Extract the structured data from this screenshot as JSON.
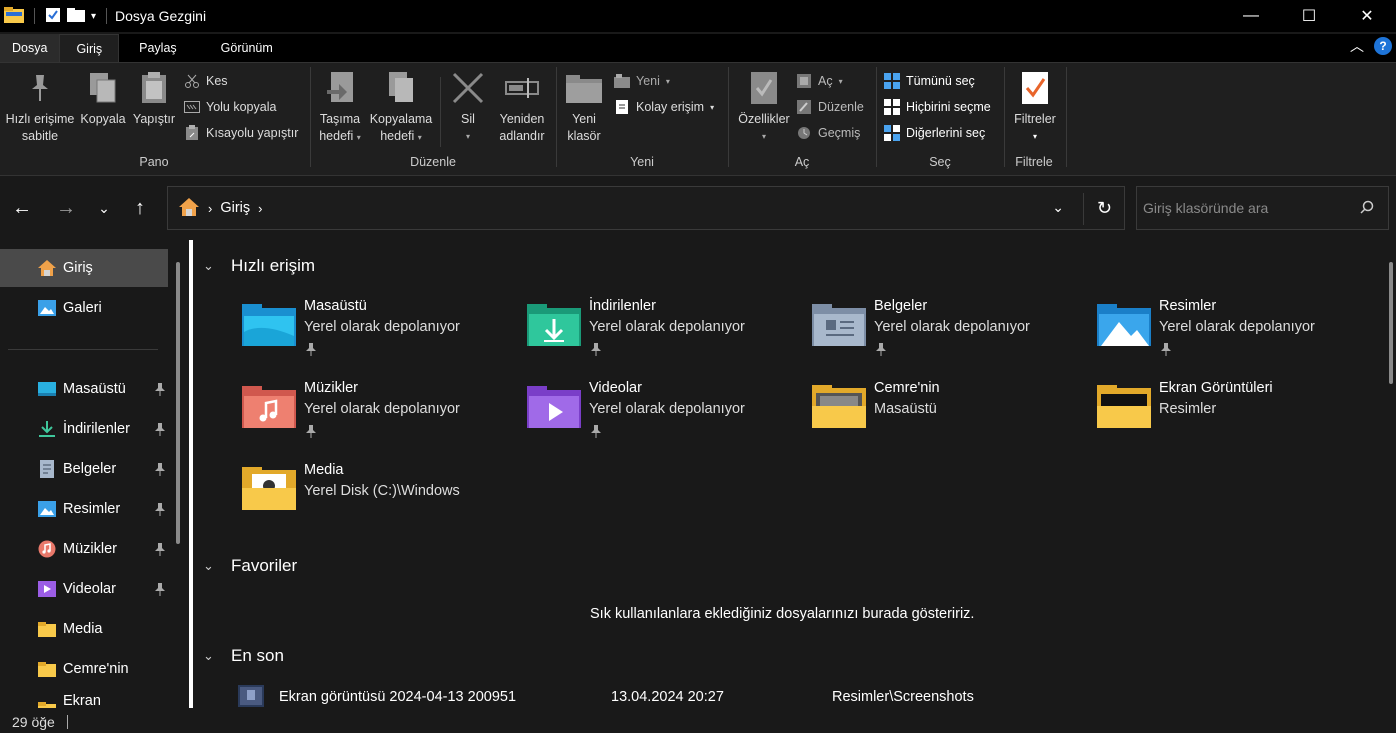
{
  "window": {
    "title": "Dosya Gezgini",
    "controls": {
      "minimize": "—",
      "maximize": "☐",
      "close": "✕"
    }
  },
  "ribbon_tabs": [
    "Dosya",
    "Giriş",
    "Paylaş",
    "Görünüm"
  ],
  "ribbon": {
    "pano": {
      "label": "Pano",
      "pin": "Hızlı erişime\nsabitle",
      "pin_l1": "Hızlı erişime",
      "pin_l2": "sabitle",
      "copy": "Kopyala",
      "paste": "Yapıştır",
      "cut": "Kes",
      "copy_path": "Yolu kopyala",
      "paste_shortcut": "Kısayolu yapıştır"
    },
    "duzenle": {
      "label": "Düzenle",
      "move_l1": "Taşıma",
      "move_l2": "hedefi",
      "copy_l1": "Kopyalama",
      "copy_l2": "hedefi",
      "delete": "Sil",
      "rename_l1": "Yeniden",
      "rename_l2": "adlandır"
    },
    "yeni": {
      "label": "Yeni",
      "folder_l1": "Yeni",
      "folder_l2": "klasör",
      "new_item": "Yeni",
      "easy_access": "Kolay erişim"
    },
    "ac": {
      "label": "Aç",
      "properties": "Özellikler",
      "open": "Aç",
      "edit": "Düzenle",
      "history": "Geçmiş"
    },
    "sec": {
      "label": "Seç",
      "select_all": "Tümünü seç",
      "select_none": "Hiçbirini seçme",
      "invert": "Diğerlerini seç"
    },
    "filtrele": {
      "label": "Filtrele",
      "filters": "Filtreler"
    }
  },
  "address": {
    "crumb": "Giriş",
    "chevron": "›"
  },
  "search": {
    "placeholder": "Giriş klasöründe ara"
  },
  "sidebar": {
    "top": [
      {
        "label": "Giriş",
        "icon": "home-icon",
        "selected": true
      },
      {
        "label": "Galeri",
        "icon": "gallery-icon"
      }
    ],
    "pinned": [
      {
        "label": "Masaüstü",
        "icon": "desktop-icon",
        "pinned": true
      },
      {
        "label": "İndirilenler",
        "icon": "download-icon",
        "pinned": true
      },
      {
        "label": "Belgeler",
        "icon": "documents-icon",
        "pinned": true
      },
      {
        "label": "Resimler",
        "icon": "pictures-icon",
        "pinned": true
      },
      {
        "label": "Müzikler",
        "icon": "music-icon",
        "pinned": true
      },
      {
        "label": "Videolar",
        "icon": "videos-icon",
        "pinned": true
      },
      {
        "label": "Media",
        "icon": "folder-icon",
        "pinned": false
      },
      {
        "label": "Cemre'nin",
        "icon": "folder-icon",
        "pinned": false
      },
      {
        "label": "Ekran Görüntüle",
        "icon": "folder-icon",
        "pinned": false
      }
    ]
  },
  "quick_access": {
    "header": "Hızlı erişim",
    "tiles": [
      {
        "name": "Masaüstü",
        "sub": "Yerel olarak depolanıyor",
        "icon": "desktop-folder-icon",
        "pinned": true
      },
      {
        "name": "İndirilenler",
        "sub": "Yerel olarak depolanıyor",
        "icon": "downloads-folder-icon",
        "pinned": true
      },
      {
        "name": "Belgeler",
        "sub": "Yerel olarak depolanıyor",
        "icon": "documents-folder-icon",
        "pinned": true
      },
      {
        "name": "Resimler",
        "sub": "Yerel olarak depolanıyor",
        "icon": "pictures-folder-icon",
        "pinned": true
      },
      {
        "name": "Müzikler",
        "sub": "Yerel olarak depolanıyor",
        "icon": "music-folder-icon",
        "pinned": true
      },
      {
        "name": "Videolar",
        "sub": "Yerel olarak depolanıyor",
        "icon": "videos-folder-icon",
        "pinned": true
      },
      {
        "name": "Cemre'nin",
        "sub": "Masaüstü",
        "icon": "folder-icon",
        "pinned": false
      },
      {
        "name": "Ekran Görüntüleri",
        "sub": "Resimler",
        "icon": "folder-icon",
        "pinned": false
      },
      {
        "name": "Media",
        "sub": "Yerel Disk (C:)\\Windows",
        "icon": "folder-icon",
        "pinned": false
      }
    ]
  },
  "favorites": {
    "header": "Favoriler",
    "empty": "Sık kullanılanlara eklediğiniz dosyalarınızı burada gösteririz."
  },
  "recent": {
    "header": "En son",
    "rows": [
      {
        "name": "Ekran görüntüsü 2024-04-13 200951",
        "date": "13.04.2024 20:27",
        "location": "Resimler\\Screenshots"
      }
    ]
  },
  "status": {
    "count": "29 öğe"
  },
  "colors": {
    "accent": "#1e74d8",
    "folder_yellow": "#f8c94a",
    "selected_bg": "#4a4a4a"
  }
}
